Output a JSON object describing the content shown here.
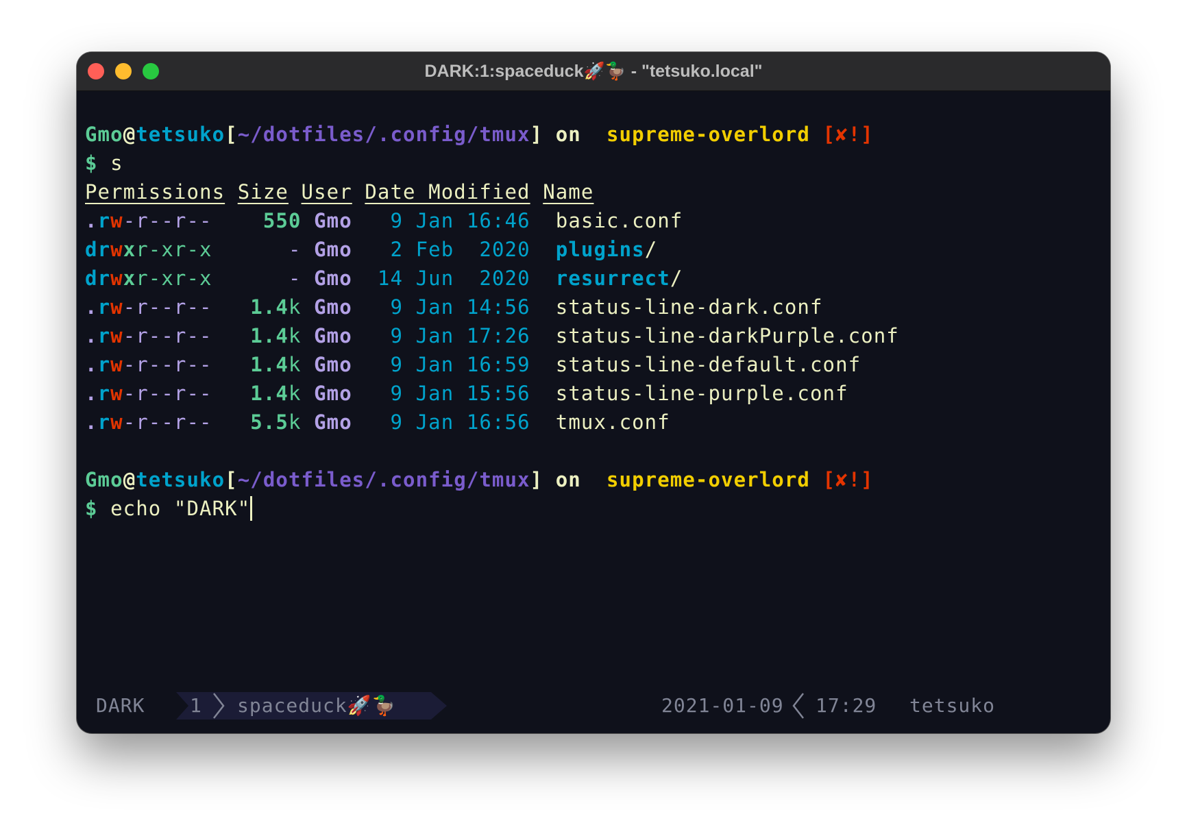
{
  "window": {
    "title": "DARK:1:spaceduck🚀🦆 - \"tetsuko.local\"",
    "colors": {
      "close": "#ff5f57",
      "minimize": "#febc2e",
      "maximize": "#28c840",
      "background": "#0f111b"
    }
  },
  "colors": {
    "green": "#5ccc96",
    "cyan": "#00a3cc",
    "purple": "#7a5ccc",
    "lavender": "#b3a1e6",
    "yellow": "#f2ce00",
    "red": "#e33400",
    "fg": "#ecf0c1",
    "grey": "#818596"
  },
  "prompt1": {
    "user": "Gmo",
    "at": "@",
    "host": "tetsuko",
    "lbr": "[",
    "path": "~/dotfiles/.config/tmux",
    "rbr": "]",
    "on": " on ",
    "branch_icon": "",
    "branch": "supreme-overlord",
    "status": "[✘!]",
    "dollar": "$",
    "command": "s"
  },
  "listing": {
    "headers": [
      "Permissions",
      "Size",
      "User",
      "Date Modified",
      "Name"
    ],
    "rows": [
      {
        "perm_type": ".",
        "perm_r": "r",
        "perm_w": "w",
        "perm_x": "-",
        "perm_rest": "r--r--",
        "size_num": "550",
        "size_unit": "",
        "user": "Gmo",
        "date": "  9 Jan 16:46",
        "name": "basic.conf",
        "is_dir": false
      },
      {
        "perm_type": "d",
        "perm_r": "r",
        "perm_w": "w",
        "perm_x": "x",
        "perm_rest": "r-xr-x",
        "size_num": "",
        "size_unit": "-",
        "user": "Gmo",
        "date": "  2 Feb  2020",
        "name": "plugins",
        "is_dir": true
      },
      {
        "perm_type": "d",
        "perm_r": "r",
        "perm_w": "w",
        "perm_x": "x",
        "perm_rest": "r-xr-x",
        "size_num": "",
        "size_unit": "-",
        "user": "Gmo",
        "date": " 14 Jun  2020",
        "name": "resurrect",
        "is_dir": true
      },
      {
        "perm_type": ".",
        "perm_r": "r",
        "perm_w": "w",
        "perm_x": "-",
        "perm_rest": "r--r--",
        "size_num": "1.4",
        "size_unit": "k",
        "user": "Gmo",
        "date": "  9 Jan 14:56",
        "name": "status-line-dark.conf",
        "is_dir": false
      },
      {
        "perm_type": ".",
        "perm_r": "r",
        "perm_w": "w",
        "perm_x": "-",
        "perm_rest": "r--r--",
        "size_num": "1.4",
        "size_unit": "k",
        "user": "Gmo",
        "date": "  9 Jan 17:26",
        "name": "status-line-darkPurple.conf",
        "is_dir": false
      },
      {
        "perm_type": ".",
        "perm_r": "r",
        "perm_w": "w",
        "perm_x": "-",
        "perm_rest": "r--r--",
        "size_num": "1.4",
        "size_unit": "k",
        "user": "Gmo",
        "date": "  9 Jan 16:59",
        "name": "status-line-default.conf",
        "is_dir": false
      },
      {
        "perm_type": ".",
        "perm_r": "r",
        "perm_w": "w",
        "perm_x": "-",
        "perm_rest": "r--r--",
        "size_num": "1.4",
        "size_unit": "k",
        "user": "Gmo",
        "date": "  9 Jan 15:56",
        "name": "status-line-purple.conf",
        "is_dir": false
      },
      {
        "perm_type": ".",
        "perm_r": "r",
        "perm_w": "w",
        "perm_x": "-",
        "perm_rest": "r--r--",
        "size_num": "5.5",
        "size_unit": "k",
        "user": "Gmo",
        "date": "  9 Jan 16:56",
        "name": "tmux.conf",
        "is_dir": false
      }
    ]
  },
  "prompt2": {
    "user": "Gmo",
    "at": "@",
    "host": "tetsuko",
    "lbr": "[",
    "path": "~/dotfiles/.config/tmux",
    "rbr": "]",
    "on": " on ",
    "branch_icon": "",
    "branch": "supreme-overlord",
    "status": "[✘!]",
    "dollar": "$",
    "command": "echo \"DARK\""
  },
  "statusbar": {
    "session": "DARK",
    "window_index": "1",
    "window_name": "spaceduck🚀🦆",
    "date": "2021-01-09",
    "time": "17:29",
    "host": "tetsuko"
  }
}
